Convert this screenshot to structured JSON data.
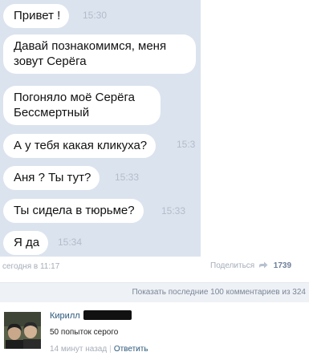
{
  "chat": {
    "messages": [
      {
        "text": "Привет !",
        "time": "15:30"
      },
      {
        "text": "Давай познакомимся, меня зовут Серёга",
        "time": ""
      },
      {
        "text": "Погоняло моё Серёга Бессмертный",
        "time": ""
      },
      {
        "text": "А у тебя какая кликуха?",
        "time": "15:3"
      },
      {
        "text": "Аня ? Ты тут?",
        "time": "15:33"
      },
      {
        "text": "Ты сидела в тюрьме?",
        "time": "15:33"
      },
      {
        "text": "Я да",
        "time": "15:34"
      }
    ]
  },
  "post": {
    "date": "сегодня в 11:17",
    "share_label": "Поделиться",
    "share_count": "1739",
    "show_more": "Показать последние 100 комментариев из 324"
  },
  "comment": {
    "author": "Кирилл",
    "text": "50 попыток серого",
    "time": "14 минут назад",
    "separator": "|",
    "reply_label": "Ответить"
  },
  "colors": {
    "chat_background": "#dbe3ee",
    "bubble": "#ffffff",
    "timestamp": "#b3bccb",
    "link": "#2b587a"
  },
  "icons": {
    "share": "share-arrow-icon"
  }
}
